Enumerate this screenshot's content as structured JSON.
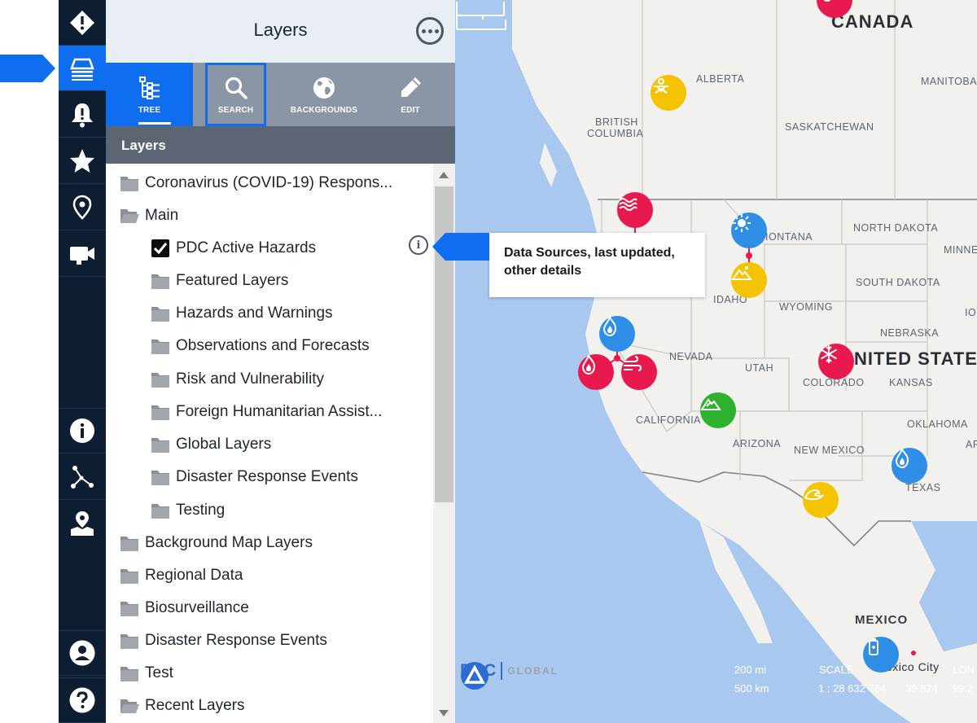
{
  "rail": {
    "items": [
      {
        "name": "hazard-alert-icon",
        "active": false
      },
      {
        "name": "layers-icon",
        "active": true
      },
      {
        "name": "bell-icon",
        "active": false
      },
      {
        "name": "star-icon",
        "active": false
      },
      {
        "name": "location-pin-icon",
        "active": false
      },
      {
        "name": "video-camera-icon",
        "active": false
      },
      {
        "name": "info-icon",
        "active": false
      },
      {
        "name": "network-icon",
        "active": false
      },
      {
        "name": "map-marker-icon",
        "active": false
      },
      {
        "name": "user-icon",
        "active": false
      },
      {
        "name": "help-icon",
        "active": false
      }
    ]
  },
  "panel": {
    "title": "Layers",
    "tabs": {
      "tree": "TREE",
      "search": "SEARCH",
      "backgrounds": "BACKGROUNDS",
      "edit": "EDIT"
    },
    "section_title": "Layers",
    "tree": [
      {
        "label": "Coronavirus (COVID-19) Respons...",
        "level": 0,
        "type": "folder-closed"
      },
      {
        "label": "Main",
        "level": 0,
        "type": "folder-open"
      },
      {
        "label": "PDC Active Hazards",
        "level": 1,
        "type": "checkbox",
        "checked": true
      },
      {
        "label": "Featured Layers",
        "level": 1,
        "type": "folder-closed"
      },
      {
        "label": "Hazards and Warnings",
        "level": 1,
        "type": "folder-closed"
      },
      {
        "label": "Observations and Forecasts",
        "level": 1,
        "type": "folder-closed"
      },
      {
        "label": "Risk and Vulnerability",
        "level": 1,
        "type": "folder-closed"
      },
      {
        "label": "Foreign Humanitarian Assist...",
        "level": 1,
        "type": "folder-closed"
      },
      {
        "label": "Global Layers",
        "level": 1,
        "type": "folder-closed"
      },
      {
        "label": "Disaster Response Events",
        "level": 1,
        "type": "folder-closed"
      },
      {
        "label": "Testing",
        "level": 1,
        "type": "folder-closed"
      },
      {
        "label": "Background Map Layers",
        "level": 0,
        "type": "folder-closed"
      },
      {
        "label": "Regional Data",
        "level": 0,
        "type": "folder-closed"
      },
      {
        "label": "Biosurveillance",
        "level": 0,
        "type": "folder-closed"
      },
      {
        "label": "Disaster Response Events",
        "level": 0,
        "type": "folder-closed"
      },
      {
        "label": "Test",
        "level": 0,
        "type": "folder-closed"
      },
      {
        "label": "Recent Layers",
        "level": 0,
        "type": "folder-open"
      }
    ],
    "info_symbol": "i"
  },
  "callout": {
    "text": "Data Sources, last updated, other details"
  },
  "map": {
    "labels": {
      "canada": "CANADA",
      "alberta": "ALBERTA",
      "manitoba": "MANITOBA",
      "british_columbia_1": "BRITISH",
      "british_columbia_2": "COLUMBIA",
      "saskatchewan": "SASKATCHEWAN",
      "north_dakota": "NORTH DAKOTA",
      "minnesota": "MINNES",
      "montana": "IONTANA",
      "south_dakota": "SOUTH DAKOTA",
      "idaho": "IDAHO",
      "wyoming": "WYOMING",
      "iowa": "IO",
      "nebraska": "NEBRASKA",
      "nevada": "NEVADA",
      "utah": "UTAH",
      "united_states": "NITED STATE",
      "colorado": "COLORADO",
      "kansas": "KANSAS",
      "california": "CALIFORNIA",
      "oklahoma": "OKLAHOMA",
      "arkansas": "AR",
      "arizona": "ARIZONA",
      "new_mexico": "NEW MEXICO",
      "texas": "TEXAS",
      "mexico": "MEXICO",
      "mexico_city": "exico City"
    },
    "hazard_colors": {
      "red": "#e8194f",
      "blue": "#2f8fe6",
      "yellow": "#f5c400",
      "green": "#2eb12e"
    },
    "logo": {
      "pdc": "PDC",
      "global": "GLOBAL"
    },
    "scale": {
      "miles": "200 mi",
      "km": "500 km",
      "scale_label": "SCALE",
      "scale_value": "1 : 28 632 784",
      "lat": "39.824",
      "lon_label": "LON",
      "lon": "99.2"
    }
  }
}
